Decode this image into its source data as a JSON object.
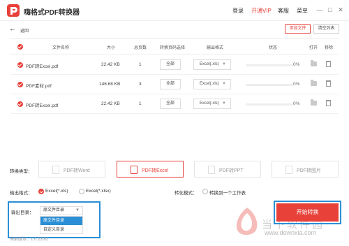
{
  "app": {
    "title": "嗨格式PDF转换器"
  },
  "topnav": {
    "login": "登录",
    "vip": "开通VIP",
    "service": "客服",
    "menu": "菜单"
  },
  "window": {
    "min": "—",
    "max": "□",
    "close": "✕"
  },
  "toolbar": {
    "back_label": "返回",
    "add_file": "添加文件",
    "clear_list": "清空列表"
  },
  "table": {
    "headers": {
      "name": "文件名称",
      "size": "大小",
      "pages": "总页数",
      "range": "转换页码选择",
      "format": "输出格式",
      "status": "状态",
      "open": "打开",
      "remove": "移除"
    },
    "rows": [
      {
        "name": "PDF转Excel.pdf",
        "size": "22.42 KB",
        "pages": "1",
        "range": "全部",
        "format": "Excel(.xls)",
        "progress": "0%",
        "progress_value": 0
      },
      {
        "name": "PDF素材.pdf",
        "size": "146.68 KB",
        "pages": "3",
        "range": "全部",
        "format": "Excel(.xls)",
        "progress": "0%",
        "progress_value": 0
      },
      {
        "name": "PDF转Excel.pdf",
        "size": "22.42 KB",
        "pages": "1",
        "range": "全部",
        "format": "Excel(.xls)",
        "progress": "0%",
        "progress_value": 0
      }
    ]
  },
  "conversion": {
    "label": "转换类型：",
    "types": [
      {
        "label": "PDF转Word",
        "active": false
      },
      {
        "label": "PDF转Excel",
        "active": true
      },
      {
        "label": "PDF转PPT",
        "active": false
      },
      {
        "label": "PDF转图片",
        "active": false
      }
    ]
  },
  "output_format": {
    "label": "输出格式：",
    "opt1": "Excel(*.xls)",
    "opt2": "Excel(*.xlsx)",
    "selected": "Excel(*.xls)"
  },
  "mode": {
    "label": "转化模式：",
    "opt": "转换到一个工作表"
  },
  "output_dir": {
    "label": "输出目录：",
    "value": "原文件目录",
    "options": [
      "原文件目录",
      "自定义目录"
    ]
  },
  "start": {
    "label": "开始转换"
  },
  "version": "当前版本：1.0.23.82",
  "watermark": {
    "big": "当下软件园",
    "url": "www.downxia.com"
  },
  "colors": {
    "accent": "#e8413a",
    "highlight": "#2a8fd6"
  }
}
